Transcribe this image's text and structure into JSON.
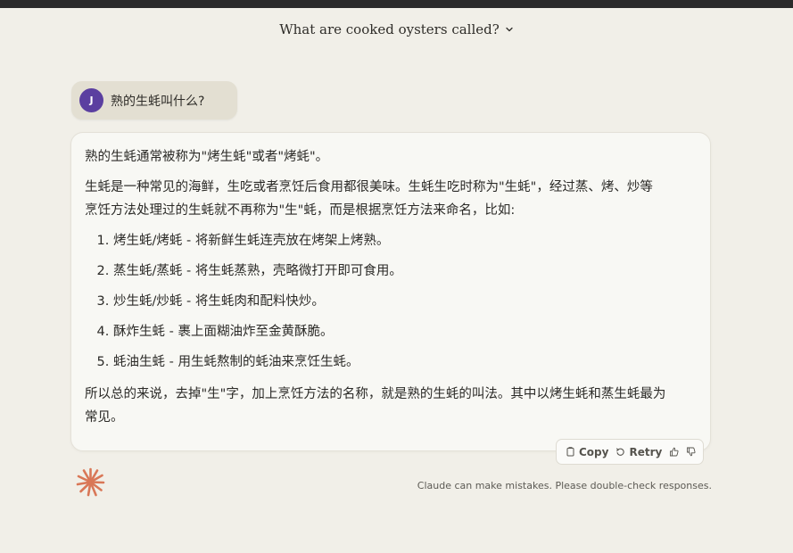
{
  "conversation": {
    "title": "What are cooked oysters called?"
  },
  "user_message": {
    "avatar_initial": "J",
    "text": "熟的生蚝叫什么?"
  },
  "assistant_message": {
    "intro": "熟的生蚝通常被称为\"烤生蚝\"或者\"烤蚝\"。",
    "paragraph": "生蚝是一种常见的海鲜，生吃或者烹饪后食用都很美味。生蚝生吃时称为\"生蚝\"，经过蒸、烤、炒等烹饪方法处理过的生蚝就不再称为\"生\"蚝，而是根据烹饪方法来命名，比如:",
    "list": [
      "烤生蚝/烤蚝 - 将新鲜生蚝连壳放在烤架上烤熟。",
      "蒸生蚝/蒸蚝 - 将生蚝蒸熟，壳略微打开即可食用。",
      "炒生蚝/炒蚝 - 将生蚝肉和配料快炒。",
      "酥炸生蚝 - 裹上面糊油炸至金黄酥脆。",
      "蚝油生蚝 - 用生蚝熬制的蚝油来烹饪生蚝。"
    ],
    "conclusion": "所以总的来说，去掉\"生\"字，加上烹饪方法的名称，就是熟的生蚝的叫法。其中以烤生蚝和蒸生蚝最为常见。"
  },
  "actions": {
    "copy": "Copy",
    "retry": "Retry"
  },
  "footer": {
    "disclaimer": "Claude can make mistakes. Please double-check responses."
  },
  "colors": {
    "background": "#f1efe8",
    "user_bubble": "#e3dfd2",
    "avatar": "#5b3fa0",
    "logo": "#d97757"
  }
}
